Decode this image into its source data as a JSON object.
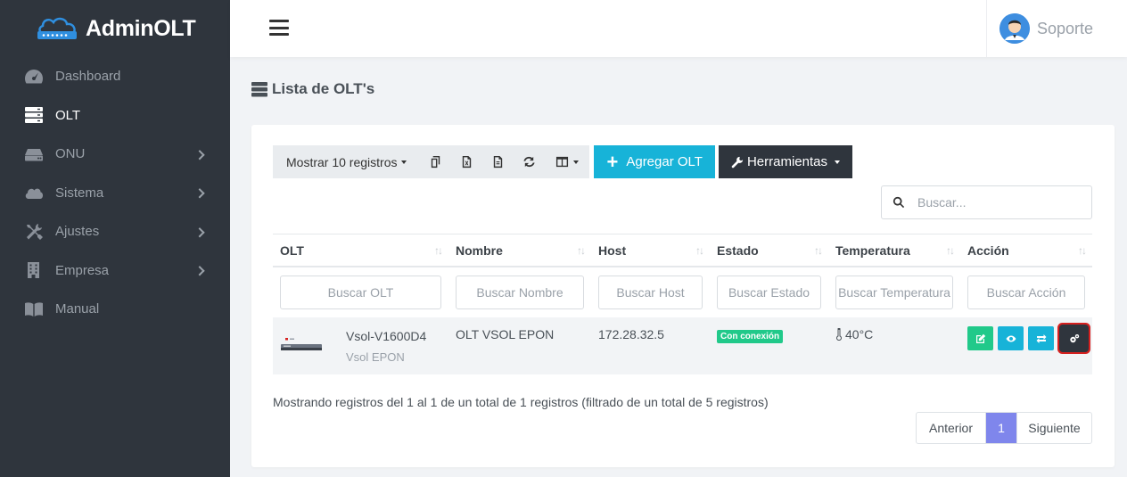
{
  "brand": {
    "name": "AdminOLT"
  },
  "sidebar": {
    "items": [
      {
        "label": "Dashboard",
        "icon": "gauge-icon",
        "chevron": false,
        "active": false
      },
      {
        "label": "OLT",
        "icon": "server-icon",
        "chevron": false,
        "active": true
      },
      {
        "label": "ONU",
        "icon": "hdd-icon",
        "chevron": true,
        "active": false
      },
      {
        "label": "Sistema",
        "icon": "cloud-icon",
        "chevron": true,
        "active": false
      },
      {
        "label": "Ajustes",
        "icon": "tools-icon",
        "chevron": true,
        "active": false
      },
      {
        "label": "Empresa",
        "icon": "building-icon",
        "chevron": true,
        "active": false
      },
      {
        "label": "Manual",
        "icon": "book-icon",
        "chevron": false,
        "active": false
      }
    ]
  },
  "topbar": {
    "user": "Soporte"
  },
  "page": {
    "title": "Lista de OLT's"
  },
  "toolbar": {
    "show_records": "Mostrar 10 registros",
    "add_label": "Agregar OLT",
    "tools_label": "Herramientas"
  },
  "search": {
    "placeholder": "Buscar..."
  },
  "table": {
    "headers": [
      "OLT",
      "Nombre",
      "Host",
      "Estado",
      "Temperatura",
      "Acción"
    ],
    "filters": [
      "Buscar OLT",
      "Buscar Nombre",
      "Buscar Host",
      "Buscar Estado",
      "Buscar Temperatura",
      "Buscar Acción"
    ],
    "rows": [
      {
        "olt_model": "Vsol-V1600D4",
        "olt_type": "Vsol EPON",
        "nombre": "OLT VSOL EPON",
        "host": "172.28.32.5",
        "estado": "Con conexión",
        "temperatura": "40°C"
      }
    ]
  },
  "footer": {
    "info": "Mostrando registros del 1 al 1 de un total de 1 registros (filtrado de un total de 5 registros)",
    "prev": "Anterior",
    "page": "1",
    "next": "Siguiente"
  },
  "colors": {
    "sidebar": "#2f353d",
    "accent_cyan": "#17b3d8",
    "accent_green": "#21c98a",
    "page_active": "#7f86ec",
    "highlight": "#d6201f"
  }
}
